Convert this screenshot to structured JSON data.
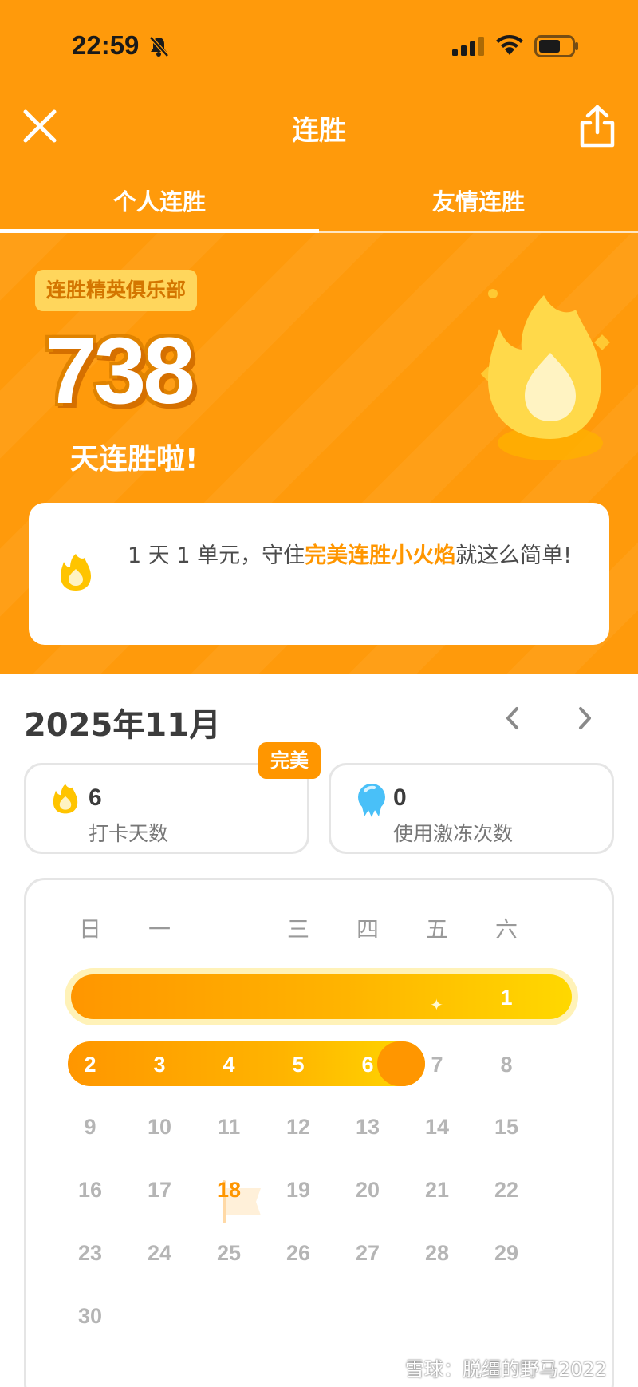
{
  "status_bar": {
    "time": "22:59"
  },
  "header": {
    "title": "连胜"
  },
  "tabs": [
    {
      "label": "个人连胜",
      "active": true
    },
    {
      "label": "友情连胜",
      "active": false
    }
  ],
  "hero": {
    "badge": "连胜精英俱乐部",
    "streak_count": "738",
    "streak_label": "天连胜啦!"
  },
  "info_card": {
    "text_before": "1 天 1 单元，守住",
    "highlight": "完美连胜小火焰",
    "text_after": "就这么简单!"
  },
  "calendar": {
    "month": "2025年11月",
    "perfect_tag": "完美",
    "stats": {
      "checkin_days": "6",
      "checkin_label": "打卡天数",
      "freeze_used": "0",
      "freeze_label": "使用激冻次数"
    },
    "weekdays": [
      "日",
      "一",
      "",
      "三",
      "四",
      "五",
      "六"
    ],
    "weeks": [
      [
        "",
        "",
        "",
        "",
        "",
        "",
        "1"
      ],
      [
        "2",
        "3",
        "4",
        "5",
        "6",
        "7",
        "8"
      ],
      [
        "9",
        "10",
        "11",
        "12",
        "13",
        "14",
        "15"
      ],
      [
        "16",
        "17",
        "18",
        "19",
        "20",
        "21",
        "22"
      ],
      [
        "23",
        "24",
        "25",
        "26",
        "27",
        "28",
        "29"
      ],
      [
        "30",
        "",
        "",
        "",
        "",
        "",
        ""
      ]
    ],
    "today": "18",
    "streak_days": [
      "1",
      "2",
      "3",
      "4",
      "5",
      "6"
    ]
  },
  "watermark": "雪球：脱缰的野马2022",
  "colors": {
    "brand_orange": "#ff9a0b",
    "accent": "#ff9600",
    "badge_yellow": "#ffd65c"
  }
}
